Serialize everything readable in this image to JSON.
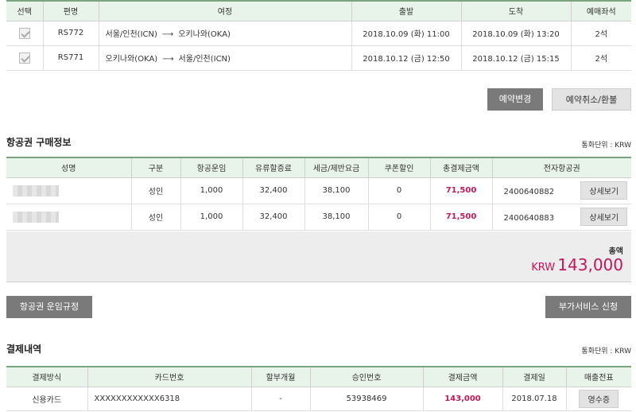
{
  "flights": {
    "headers": [
      "선택",
      "편명",
      "여정",
      "출발",
      "도착",
      "예매좌석"
    ],
    "rows": [
      {
        "flight": "RS772",
        "from": "서울/인천(ICN)",
        "arrow": "⟶",
        "to": "오키나와(OKA)",
        "depart": "2018.10.09 (화) 11:00",
        "arrive": "2018.10.09 (화) 13:20",
        "seats": "2석"
      },
      {
        "flight": "RS771",
        "from": "오키나와(OKA)",
        "arrow": "⟶",
        "to": "서울/인천(ICN)",
        "depart": "2018.10.12 (금) 12:50",
        "arrive": "2018.10.12 (금) 15:15",
        "seats": "2석"
      }
    ]
  },
  "actions": {
    "change": "예약변경",
    "cancel": "예약취소/환불"
  },
  "ticket_section": {
    "title": "항공권 구매정보",
    "currency": "통화단위 : KRW"
  },
  "tickets": {
    "headers": [
      "성명",
      "구분",
      "항공운임",
      "유류할증료",
      "세금/제반요금",
      "쿠폰할인",
      "총결제금액",
      "전자항공권"
    ],
    "rows": [
      {
        "type": "성인",
        "fare": "1,000",
        "fuel": "32,400",
        "tax": "38,100",
        "coupon": "0",
        "total": "71,500",
        "ticket_no": "2400640882",
        "detail": "상세보기"
      },
      {
        "type": "성인",
        "fare": "1,000",
        "fuel": "32,400",
        "tax": "38,100",
        "coupon": "0",
        "total": "71,500",
        "ticket_no": "2400640883",
        "detail": "상세보기"
      }
    ]
  },
  "total": {
    "label": "총액",
    "currency": "KRW",
    "amount": "143,000"
  },
  "buttons": {
    "fare_rules": "항공권 운임규정",
    "extra_service": "부가서비스 신청"
  },
  "payment_section": {
    "title": "결제내역",
    "currency": "통화단위 : KRW"
  },
  "payment": {
    "headers": [
      "결제방식",
      "카드번호",
      "할부개월",
      "승인번호",
      "결제금액",
      "결제일",
      "매출전표"
    ],
    "rows": [
      {
        "method": "신용카드",
        "card": "XXXXXXXXXXXX6318",
        "installment": "-",
        "approval": "53938469",
        "amount": "143,000",
        "date": "2018.07.18",
        "receipt": "영수증"
      }
    ]
  },
  "colors": {
    "accent_green": "#7aa37f",
    "header_bg": "#e8f3ea",
    "price_pink": "#c2185b"
  }
}
